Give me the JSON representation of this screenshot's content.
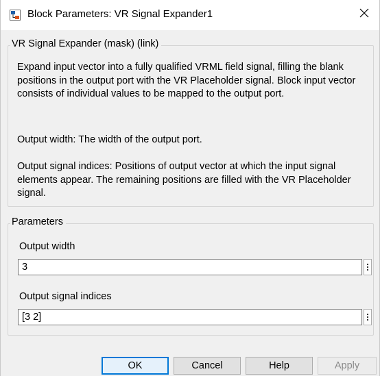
{
  "window": {
    "title": "Block Parameters: VR Signal Expander1",
    "icon": "simulink-block-icon",
    "close_label": "✕"
  },
  "description": {
    "group_title": "VR Signal Expander (mask) (link)",
    "paragraph1": "Expand input vector into a fully qualified VRML field signal, filling the blank positions in the output port with the VR Placeholder signal. Block input vector consists of individual values to be mapped to the output port.",
    "paragraph2": "Output width: The width of the output port.",
    "paragraph3": "Output signal indices: Positions of output vector at which the input signal elements appear. The remaining positions are filled with the VR Placeholder signal."
  },
  "parameters": {
    "group_title": "Parameters",
    "output_width": {
      "label": "Output width",
      "value": "3"
    },
    "output_signal_indices": {
      "label": "Output signal indices",
      "value": "[3 2]"
    }
  },
  "buttons": {
    "ok": "OK",
    "cancel": "Cancel",
    "help": "Help",
    "apply": "Apply"
  },
  "colors": {
    "default_button_border": "#0078d7",
    "dialog_background": "#f0f0f0",
    "disabled_text": "#8a8a8a"
  }
}
